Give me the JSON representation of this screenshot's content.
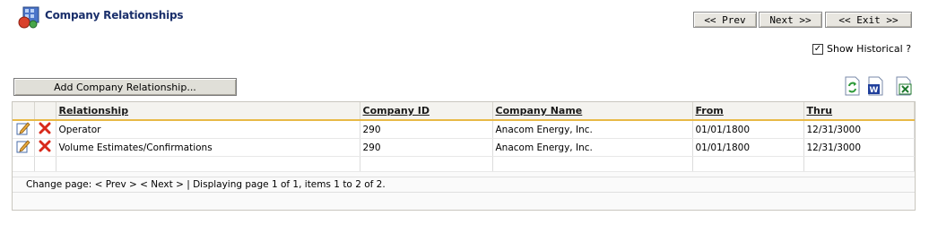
{
  "header": {
    "title": "Company Relationships"
  },
  "nav": {
    "prev_label": "<< Prev",
    "next_label": "Next >>",
    "exit_label": "<< Exit >>"
  },
  "options": {
    "show_historical_label": "Show Historical ?",
    "show_historical_checked": "✓"
  },
  "toolbar": {
    "add_label": "Add Company Relationship..."
  },
  "export": {
    "refresh_icon": "refresh-icon",
    "word_icon": "word-export-icon",
    "excel_icon": "excel-export-icon"
  },
  "table": {
    "columns": [
      "Relationship",
      "Company ID",
      "Company Name",
      "From",
      "Thru"
    ],
    "rows": [
      {
        "relationship": "Operator",
        "company_id": "290",
        "company_name": "Anacom Energy, Inc.",
        "from": "01/01/1800",
        "thru": "12/31/3000"
      },
      {
        "relationship": "Volume Estimates/Confirmations",
        "company_id": "290",
        "company_name": "Anacom Energy, Inc.",
        "from": "01/01/1800",
        "thru": "12/31/3000"
      }
    ]
  },
  "pager": {
    "text": "Change page: < Prev > < Next > | Displaying page 1 of 1, items 1 to 2 of 2."
  }
}
